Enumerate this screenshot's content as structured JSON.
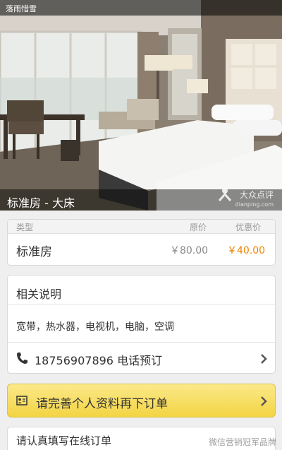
{
  "status_bar": {
    "text": "落雨惜雪"
  },
  "hero": {
    "caption": "标准房 - 大床",
    "watermark_logo": "大众点评",
    "watermark_sub": "dianping.com"
  },
  "price_table": {
    "headers": {
      "type": "类型",
      "original": "原价",
      "discount": "优惠价"
    },
    "row": {
      "name": "标准房",
      "original_price": "￥80.00",
      "discount_price": "￥40.00"
    }
  },
  "description": {
    "title": "相关说明",
    "amenities": "宽带，热水器，电视机，电脑，空调",
    "phone_line": "18756907896 电话预订"
  },
  "order_button": {
    "label": "请完善个人资料再下订单"
  },
  "form_section": {
    "title": "请认真填写在线订单"
  },
  "footer_watermark": "微信营销冠军品牌",
  "colors": {
    "discount": "#f08200",
    "button_top": "#fbe98a",
    "button_bottom": "#f3d443"
  },
  "icons": [
    "phone-icon",
    "chevron-right-icon",
    "profile-card-icon",
    "dianping-logo-icon"
  ]
}
